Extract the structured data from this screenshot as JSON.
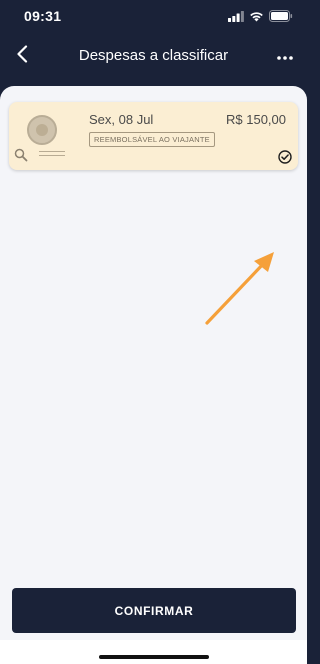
{
  "status_bar": {
    "time": "09:31",
    "icons": [
      "cellular-signal-icon",
      "wifi-icon",
      "battery-icon"
    ]
  },
  "header": {
    "title": "Despesas a classificar",
    "back_icon": "chevron-left-icon",
    "menu_icon": "more-horizontal-icon"
  },
  "expenses": [
    {
      "date": "Sex, 08 Jul",
      "amount": "R$ 150,00",
      "badge": "REEMBOLSÁVEL AO VIAJANTE",
      "selected": true,
      "card_color": "#fbeed3"
    }
  ],
  "footer": {
    "confirm_label": "CONFIRMAR"
  },
  "colors": {
    "primary": "#1a2238",
    "background": "#f4f5f9",
    "card": "#fbeed3",
    "annotation_arrow": "#f5a03a"
  }
}
